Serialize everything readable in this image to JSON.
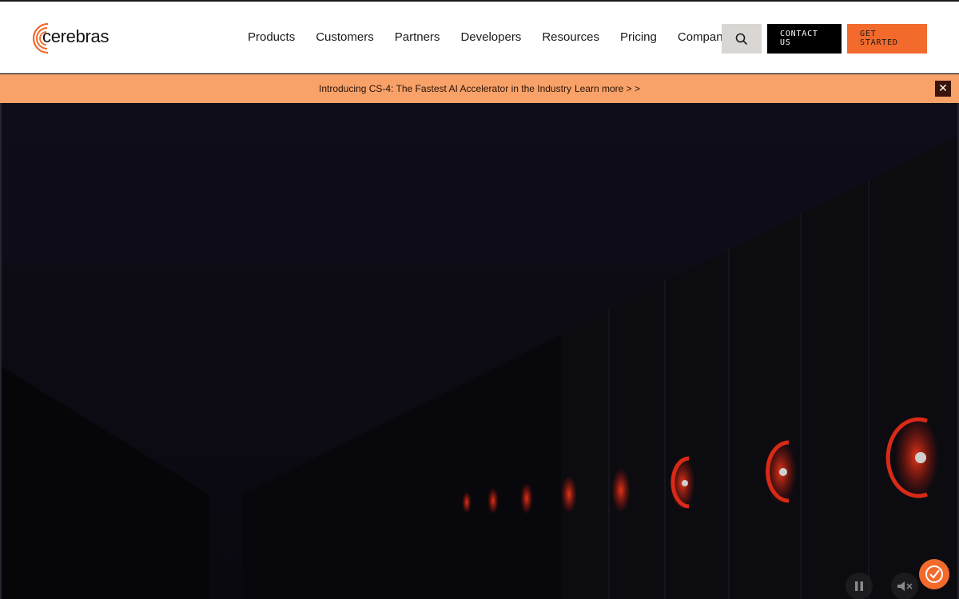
{
  "brand": {
    "name": "cerebras",
    "accent": "#f26a2c"
  },
  "nav": {
    "items": [
      {
        "label": "Products"
      },
      {
        "label": "Customers"
      },
      {
        "label": "Partners"
      },
      {
        "label": "Developers"
      },
      {
        "label": "Resources"
      },
      {
        "label": "Pricing"
      },
      {
        "label": "Company"
      }
    ],
    "search_icon": "search-icon",
    "contact_label_1": "CONTACT",
    "contact_label_2": "US",
    "started_label_1": "GET",
    "started_label_2": "STARTED"
  },
  "banner": {
    "text": "Introducing CS-4: The Fastest AI Accelerator in the Industry",
    "link": "Learn more > >",
    "close_icon": "close-icon",
    "background": "#f8a269"
  },
  "hero": {
    "pause_icon": "pause-icon",
    "mute_icon": "mute-icon",
    "consent_icon": "cookie-consent-icon"
  }
}
